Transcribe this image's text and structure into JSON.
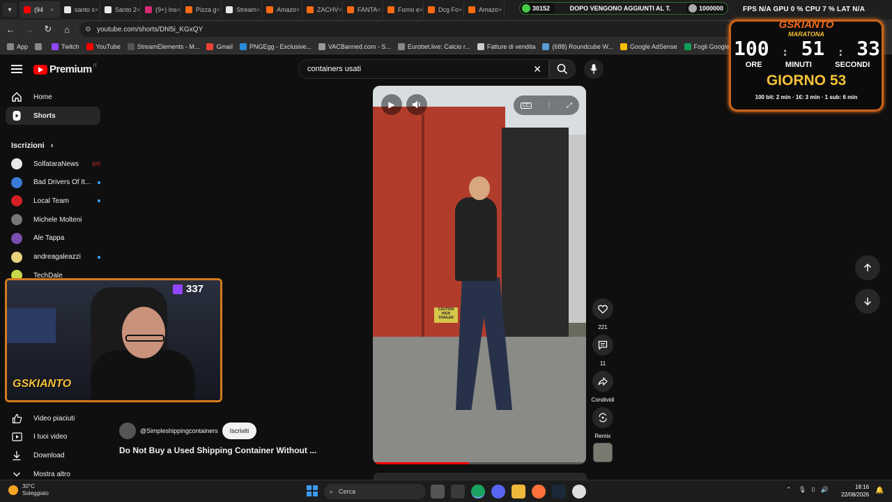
{
  "browser": {
    "tabs": [
      {
        "label": "(94",
        "fav": "#ff0000",
        "active": true
      },
      {
        "label": "santo s",
        "fav": "#e8e8e8"
      },
      {
        "label": "Santo 2",
        "fav": "#e8e8e8"
      },
      {
        "label": "(9+) Ins",
        "fav": "#d62976"
      },
      {
        "label": "Pizza g",
        "fav": "#ff6a13"
      },
      {
        "label": "Stream",
        "fav": "#e8e8e8"
      },
      {
        "label": "Amazo",
        "fav": "#ff6a13"
      },
      {
        "label": "ZACHV",
        "fav": "#ff6a13"
      },
      {
        "label": "FANTA",
        "fav": "#ff6a13"
      },
      {
        "label": "Forno e",
        "fav": "#ff6a13"
      },
      {
        "label": "Dcg Fo",
        "fav": "#ff6a13"
      },
      {
        "label": "Amazo",
        "fav": "#ff6a13"
      }
    ],
    "tab_close": "×",
    "address": "youtube.com/shorts/Dhl5i_KGxQY",
    "bookmarks": [
      {
        "label": "App",
        "color": "#888"
      },
      {
        "label": "",
        "color": "#888"
      },
      {
        "label": "Twitch",
        "color": "#9146ff"
      },
      {
        "label": "YouTube",
        "color": "#ff0000"
      },
      {
        "label": "StreamElements - M...",
        "color": "#555"
      },
      {
        "label": "Gmail",
        "color": "#ea4335"
      },
      {
        "label": "PNGEgg - Exclusive...",
        "color": "#2a8cd8"
      },
      {
        "label": "VACBanned.com - S...",
        "color": "#999"
      },
      {
        "label": "Eurobet.live: Calcio r...",
        "color": "#888"
      },
      {
        "label": "Fatture di vendita",
        "color": "#ccc"
      },
      {
        "label": "(688) Roundcube W...",
        "color": "#5a9bd4"
      },
      {
        "label": "Google AdSense",
        "color": "#fbbc04"
      },
      {
        "label": "Fogli Google",
        "color": "#0f9d58"
      },
      {
        "label": "txAdmin",
        "color": "#2fa86b"
      }
    ]
  },
  "stream_overlay": {
    "ticker_left": "30152",
    "ticker_msg": "DOPO VENGONO AGGIUNTI AL T.",
    "ticker_right": "1000000",
    "stats": "FPS N/A   GPU 0 %   CPU 7 %   LAT N/A",
    "viewers": "337",
    "cam_logo": "GSKIANTO",
    "timer": {
      "brand": "GSKIANTO",
      "subtitle": "MARATONA",
      "hours": "100",
      "minutes": "51",
      "seconds": "33",
      "colon": ":",
      "u_hours": "ORE",
      "u_minutes": "MINUTI",
      "u_seconds": "SECONDI",
      "day": "GIORNO 53",
      "rules": "100 bit: 2 min · 1€: 3 min · 1 sub: 6 min"
    }
  },
  "youtube": {
    "logo_text": "Premium",
    "logo_region": "IT",
    "search_value": "containers usati",
    "nav": [
      {
        "label": "Home",
        "icon": "home-icon",
        "selected": false
      },
      {
        "label": "Shorts",
        "icon": "shorts-icon",
        "selected": true
      }
    ],
    "subscriptions_title": "Iscrizioni",
    "subscriptions": [
      {
        "name": "SolfataraNews",
        "color": "#e8e8e8",
        "badge": "live"
      },
      {
        "name": "Bad Drivers Of It...",
        "color": "#3a7bd5",
        "badge": "dot"
      },
      {
        "name": "Local Team",
        "color": "#d32027",
        "badge": "dot"
      },
      {
        "name": "Michele Molteni",
        "color": "#777",
        "badge": ""
      },
      {
        "name": "Ale Tappa",
        "color": "#7b4fb0",
        "badge": ""
      },
      {
        "name": "andreagaleazzi",
        "color": "#e6d27a",
        "badge": "dot"
      },
      {
        "name": "TechDale",
        "color": "#c8d84a",
        "badge": ""
      }
    ],
    "lower_nav": [
      {
        "label": "Video piaciuti",
        "icon": "thumbs-up-icon"
      },
      {
        "label": "I tuoi video",
        "icon": "video-icon"
      },
      {
        "label": "Download",
        "icon": "download-icon"
      },
      {
        "label": "Mostra altro",
        "icon": "chevron-down-icon"
      }
    ],
    "short": {
      "channel": "@Simpleshippingcontainers",
      "subscribe": "Iscriviti",
      "title": "Do Not Buy a Used Shipping Container Without ...",
      "caution_label": "CAUTION HIGH TRAILER",
      "progress": 0.45,
      "likes": "221",
      "comments": "11",
      "share": "Condividi",
      "remix": "Remix"
    }
  },
  "taskbar": {
    "temp": "30°C",
    "weather": "Soleggiato",
    "search": "Cerca",
    "time": "18:16",
    "date": "22/08/2026",
    "apps": [
      "#555555",
      "#3a3a3a",
      "#1aa260",
      "#5865f2",
      "#f0b73d",
      "#ff7139",
      "#1b2838",
      "#dddddd"
    ]
  }
}
